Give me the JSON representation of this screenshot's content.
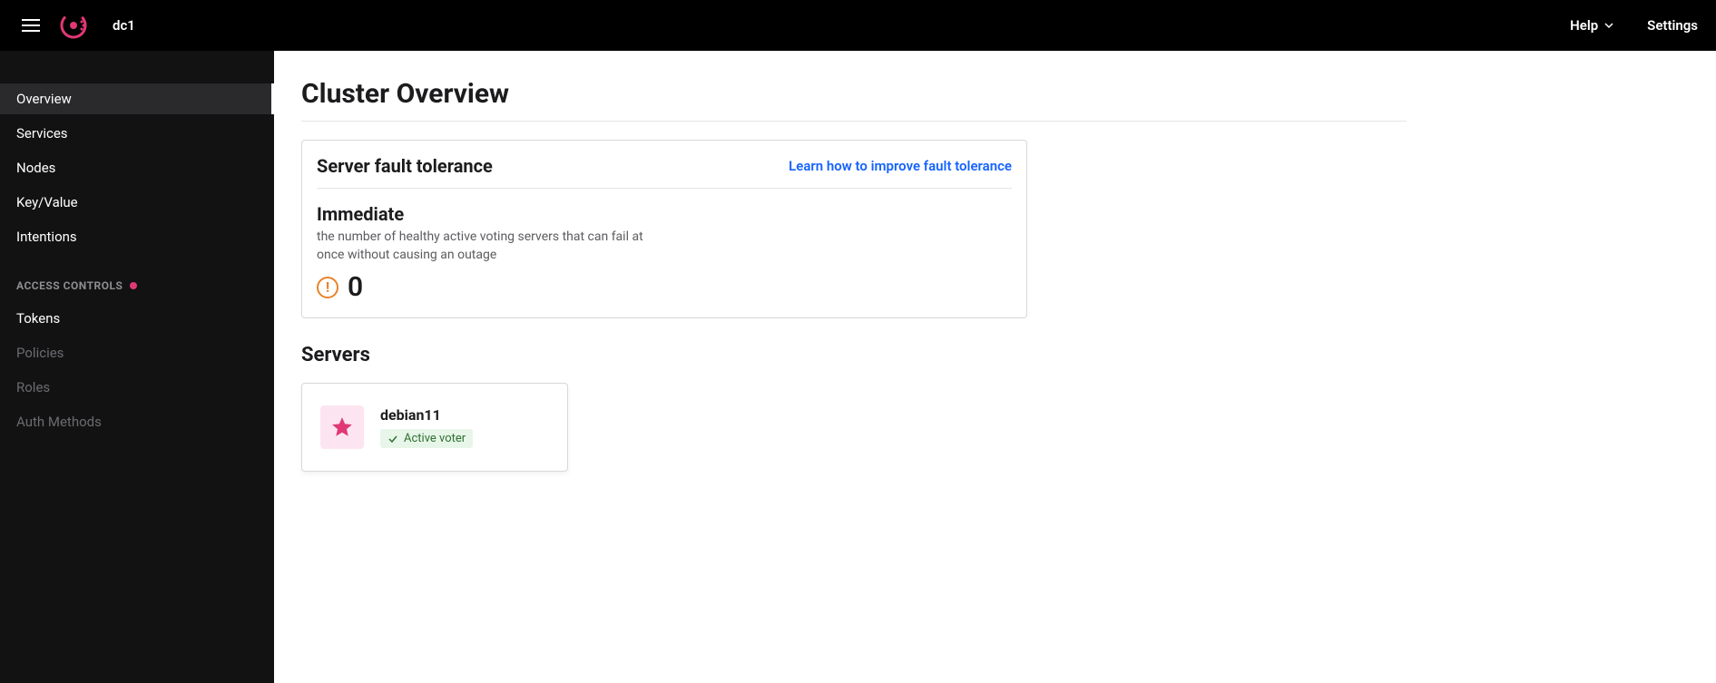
{
  "header": {
    "datacenter": "dc1",
    "help_label": "Help",
    "settings_label": "Settings"
  },
  "sidebar": {
    "items": [
      {
        "label": "Overview",
        "active": true,
        "disabled": false
      },
      {
        "label": "Services",
        "active": false,
        "disabled": false
      },
      {
        "label": "Nodes",
        "active": false,
        "disabled": false
      },
      {
        "label": "Key/Value",
        "active": false,
        "disabled": false
      },
      {
        "label": "Intentions",
        "active": false,
        "disabled": false
      }
    ],
    "access_section_label": "ACCESS CONTROLS",
    "access_items": [
      {
        "label": "Tokens",
        "disabled": false
      },
      {
        "label": "Policies",
        "disabled": true
      },
      {
        "label": "Roles",
        "disabled": true
      },
      {
        "label": "Auth Methods",
        "disabled": true
      }
    ]
  },
  "main": {
    "page_title": "Cluster Overview",
    "fault_tolerance": {
      "card_title": "Server fault tolerance",
      "learn_link": "Learn how to improve fault tolerance",
      "metric_title": "Immediate",
      "metric_description": "the number of healthy active voting servers that can fail at once without causing an outage",
      "metric_value": "0"
    },
    "servers": {
      "section_title": "Servers",
      "items": [
        {
          "name": "debian11",
          "status": "Active voter"
        }
      ]
    }
  }
}
